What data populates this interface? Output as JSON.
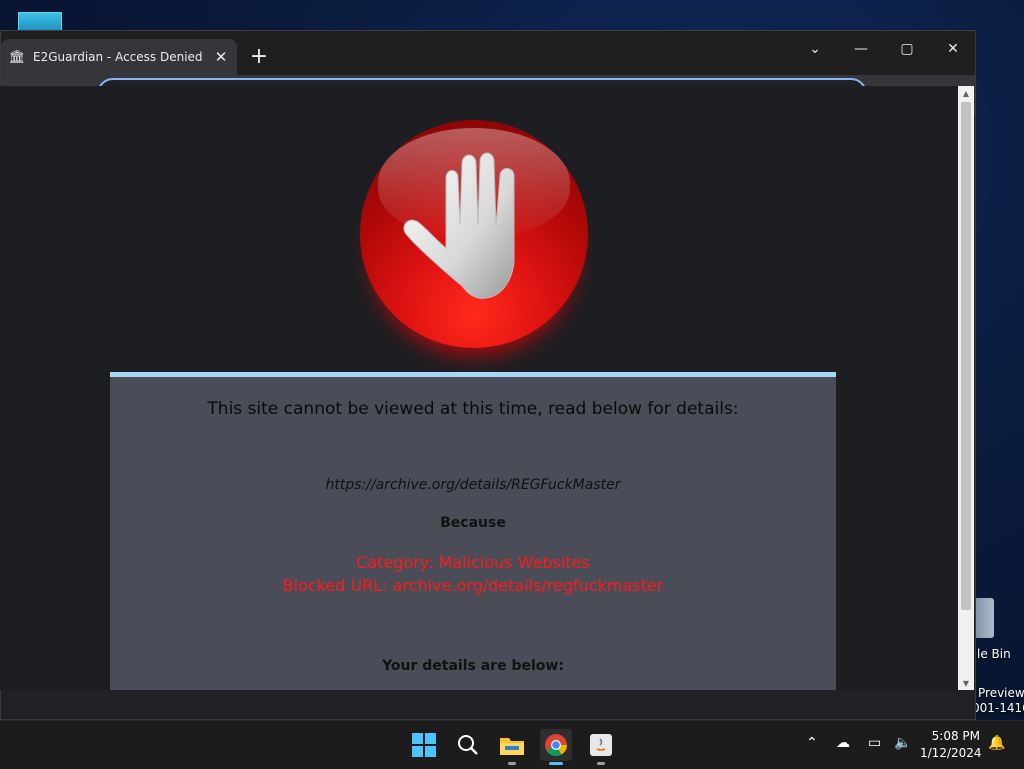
{
  "desktop": {
    "recycle_label": "le Bin",
    "preview_label": "Preview",
    "build_label": "001-1416"
  },
  "browser": {
    "tab_title": "E2Guardian - Access Denied",
    "omnibox_value": ""
  },
  "page": {
    "title": "This site cannot be viewed at this time, read below for details:",
    "blocked_url": "https://archive.org/details/REGFuckMaster",
    "because": "Because",
    "category": "Category: Malicious Websites",
    "blocked_line": "Blocked URL: archive.org/details/regfuckmaster",
    "details_heading": "Your details are below:"
  },
  "taskbar": {
    "time": "5:08 PM",
    "date": "1/12/2024"
  },
  "colors": {
    "accent": "#8ab4f8",
    "error_red": "#ff1a1a",
    "panel_bg": "#4a4d57",
    "panel_border": "#a8d8f5"
  }
}
